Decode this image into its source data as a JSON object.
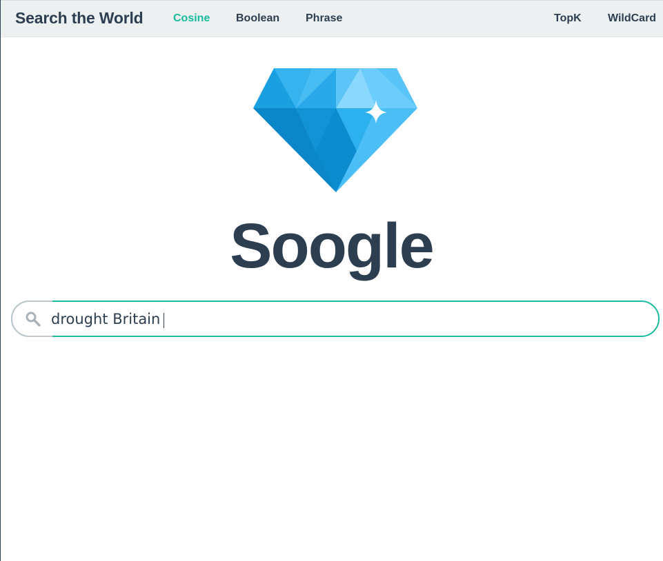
{
  "navbar": {
    "brand": "Search the World",
    "links": [
      {
        "label": "Cosine",
        "active": true
      },
      {
        "label": "Boolean",
        "active": false
      },
      {
        "label": "Phrase",
        "active": false
      },
      {
        "label": "TopK",
        "active": false
      },
      {
        "label": "WildCard",
        "active": false
      }
    ]
  },
  "logo": {
    "icon": "diamond-icon",
    "wordmark": "Soogle"
  },
  "search": {
    "icon": "search-icon",
    "value": "drought Britain",
    "placeholder": ""
  },
  "colors": {
    "accent": "#18bc9c",
    "text": "#2c3e50",
    "navbar_bg": "#ecf0f1",
    "diamond_light": "#6dcbfb",
    "diamond_mid": "#29aae2",
    "diamond_dark": "#0b86c9"
  }
}
